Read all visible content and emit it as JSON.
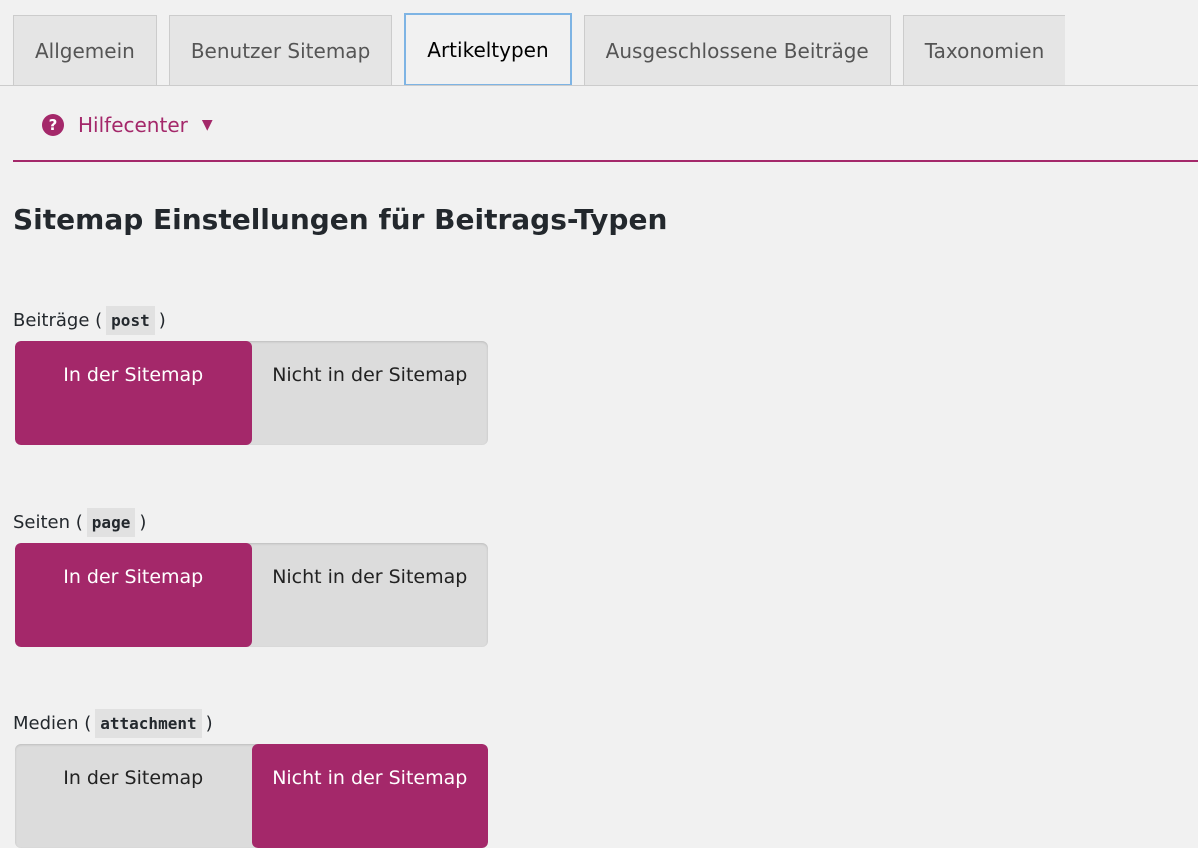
{
  "tabs": [
    {
      "label": "Allgemein",
      "active": false
    },
    {
      "label": "Benutzer Sitemap",
      "active": false
    },
    {
      "label": "Artikeltypen",
      "active": true
    },
    {
      "label": "Ausgeschlossene Beiträge",
      "active": false
    },
    {
      "label": "Taxonomien",
      "active": false
    }
  ],
  "help": {
    "label": "Hilfecenter",
    "icon": "question-circle-icon",
    "caret_icon": "caret-down-icon"
  },
  "colors": {
    "accent": "#a4286a",
    "active_tab_border": "#7eb4e4"
  },
  "section_title": "Sitemap Einstellungen für Beitrags-Typen",
  "post_types": [
    {
      "name": "Beiträge",
      "slug": "post",
      "options": [
        "In der Sitemap",
        "Nicht in der Sitemap"
      ],
      "selected": 0
    },
    {
      "name": "Seiten",
      "slug": "page",
      "options": [
        "In der Sitemap",
        "Nicht in der Sitemap"
      ],
      "selected": 0
    },
    {
      "name": "Medien",
      "slug": "attachment",
      "options": [
        "In der Sitemap",
        "Nicht in der Sitemap"
      ],
      "selected": 1
    }
  ]
}
